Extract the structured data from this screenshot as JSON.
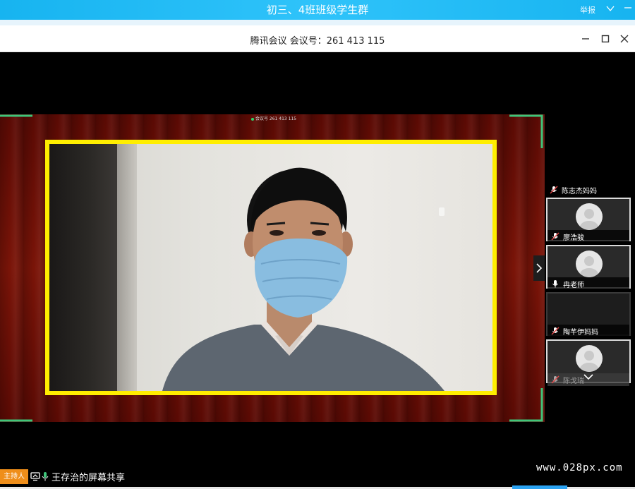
{
  "group_bar": {
    "title": "初三、4班班级学生群",
    "report_label": "举报"
  },
  "meeting_bar": {
    "title": "腾讯会议 会议号：261 413 115"
  },
  "video": {
    "id_overlay": "会议号 261 413 115"
  },
  "participants": [
    {
      "name": "陈志杰妈妈",
      "mic": "muted",
      "has_avatar": true
    },
    {
      "name": "廖浩骏",
      "mic": "muted",
      "has_avatar": true
    },
    {
      "name": "冉老师",
      "mic": "on",
      "has_avatar": false
    },
    {
      "name": "陶芊伊妈妈",
      "mic": "muted",
      "has_avatar": true
    },
    {
      "name": "陈戈瑞",
      "mic": "muted",
      "has_avatar": false
    }
  ],
  "bottom": {
    "host_badge": "主持人",
    "sharer_label": "王存治的屏幕共享",
    "watermark": "www.028px.com"
  },
  "colors": {
    "group_bar": "#2fc3fa",
    "frame_border": "#ffee00",
    "corner_marks": "#3fc57a",
    "host_badge": "#ef8e1a",
    "muted_mic": "#e04848"
  },
  "icons": [
    "chevron-down-icon",
    "minimize-icon",
    "maximize-icon",
    "close-icon",
    "chevron-right-icon",
    "mic-muted-icon",
    "mic-icon",
    "screen-share-icon",
    "avatar-icon"
  ]
}
